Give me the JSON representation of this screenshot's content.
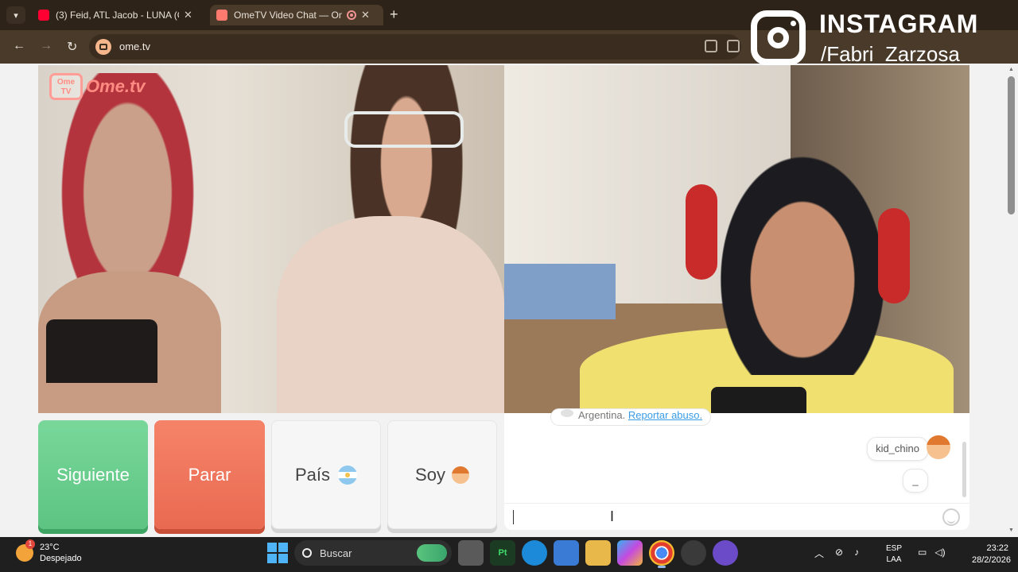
{
  "browser": {
    "tabs": [
      {
        "label": "(3) Feid, ATL Jacob - LUNA (Offi",
        "favicon": "youtube-icon",
        "favicon_color": "#ff0033"
      },
      {
        "label": "OmeTV Video Chat — Ome",
        "favicon": "ometv-icon",
        "favicon_color": "#ff7a6e",
        "recording": true
      }
    ],
    "new_tab_label": "+",
    "url": "ome.tv"
  },
  "overlay": {
    "title": "INSTAGRAM",
    "handle": "/Fabri_Zarzosa"
  },
  "video": {
    "logo_box": "Ome TV",
    "logo_word": "Ome.tv"
  },
  "buttons": {
    "next": "Siguiente",
    "stop": "Parar",
    "country": "País",
    "gender": "Soy"
  },
  "chat": {
    "system_country": "Argentina.",
    "system_link": "Reportar abuso.",
    "messages": [
      {
        "text": "kid_chino"
      },
      {
        "text": "_"
      }
    ],
    "input_value": ""
  },
  "taskbar": {
    "weather_temp": "23°C",
    "weather_desc": "Despejado",
    "weather_badge": "1",
    "search_placeholder": "Buscar",
    "lang_top": "ESP",
    "lang_bottom": "LAA",
    "time": "23:22",
    "date": "28/2/2026"
  },
  "colors": {
    "next": "#5cc482",
    "stop": "#e96a51",
    "browser_frame": "#4a3a29",
    "link": "#3a9be6"
  }
}
